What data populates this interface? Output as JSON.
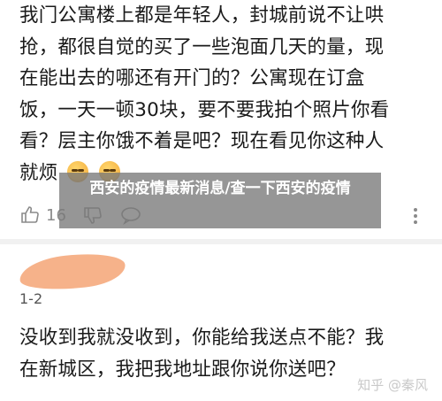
{
  "comment1": {
    "lines": [
      "我门公寓楼上都是年轻人，封城前说不让哄",
      "抢，都很自觉的买了一些泡面几天的量，现",
      "在能出去的哪还有开门的？公寓现在订盒",
      "饭，一天一顿30块，要不要我拍个照片你看",
      "看？层主你饿不着是吧？现在看见你这种人",
      "就烦"
    ],
    "like_count": "16"
  },
  "overlay": {
    "title": "西安的疫情最新消息/查一下西安的疫情"
  },
  "comment2": {
    "index": "1-2",
    "lines": [
      "没收到我就没收到，你能给我送点不能？我",
      "在新城区，我把我地址跟你说你送吧？"
    ]
  },
  "watermark": {
    "text": "知乎 @秦风"
  },
  "icons": {
    "like": "thumbs-up-icon",
    "dislike": "thumbs-down-icon",
    "comment": "comment-bubble-icon",
    "more": "more-vertical-icon",
    "emoji": "squint-face-emoji-icon"
  }
}
